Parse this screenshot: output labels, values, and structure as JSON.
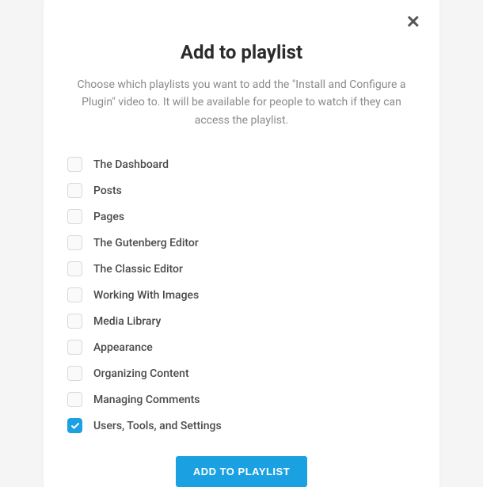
{
  "modal": {
    "title": "Add to playlist",
    "description": "Choose which playlists you want to add the \"Install and Configure a Plugin\" video to. It will be available for people to watch if they can access the playlist.",
    "close_label": "✕",
    "submit_label": "ADD TO PLAYLIST"
  },
  "playlists": [
    {
      "label": "The Dashboard",
      "checked": false
    },
    {
      "label": "Posts",
      "checked": false
    },
    {
      "label": "Pages",
      "checked": false
    },
    {
      "label": "The Gutenberg Editor",
      "checked": false
    },
    {
      "label": "The Classic Editor",
      "checked": false
    },
    {
      "label": "Working With Images",
      "checked": false
    },
    {
      "label": "Media Library",
      "checked": false
    },
    {
      "label": "Appearance",
      "checked": false
    },
    {
      "label": "Organizing Content",
      "checked": false
    },
    {
      "label": "Managing Comments",
      "checked": false
    },
    {
      "label": "Users, Tools, and Settings",
      "checked": true
    }
  ]
}
